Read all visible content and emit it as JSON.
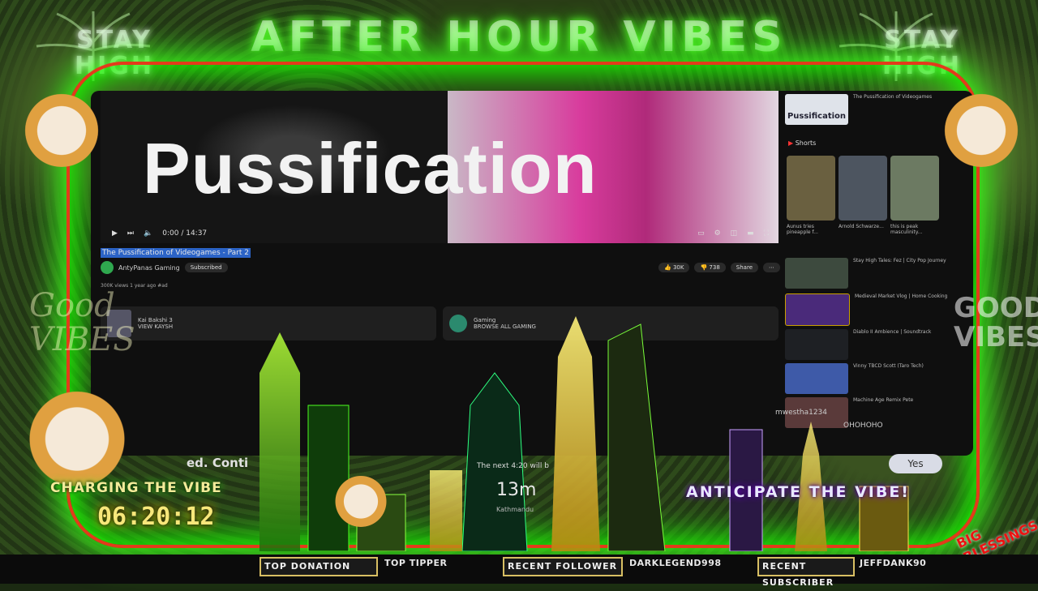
{
  "overlay": {
    "banner_title": "AFTER HOUR VIBES",
    "stay_high": "STAY HIGH",
    "good_vibes_left": "Good VIBES",
    "good_vibes_right": "GOOD VIBES",
    "charging_label": "CHARGING THE VIBE",
    "countdown": "06:20:12",
    "anticipate_label": "ANTICIPATE THE VIBE!",
    "big_blessings": "BIG BLESSINGS",
    "webcam_caption": "ed. Conti",
    "accent_green": "#38ff18",
    "accent_red": "#e33b1a"
  },
  "video": {
    "overlay_title": "Pussification",
    "title": "The Pussification of Videogames - Part 2",
    "channel": "AntyPanas Gaming",
    "subscribe": "Subscribed",
    "likes": "30K",
    "dislikes": "738",
    "share": "Share",
    "time": "0:00 / 14:37",
    "description": "300K views  1 year ago  #ad"
  },
  "cards": [
    {
      "title": "Kai Bakshi 3",
      "sub": "VIEW KAYSH"
    },
    {
      "title": "Gaming",
      "sub": "BROWSE ALL GAMING"
    }
  ],
  "sidebar": {
    "top_title": "The Pussification of Videogames",
    "top_label": "Pussification",
    "shorts_label": "Shorts",
    "shorts": [
      {
        "caption": "Aunus tries pineapple f..."
      },
      {
        "caption": "Arnold Schwarze..."
      },
      {
        "caption": "this is peak masculinity..."
      }
    ],
    "items": [
      {
        "title": "Stay High Tales: Fez | City Pop Journey"
      },
      {
        "title": "Medieval Market Vlog | Home Cooking"
      },
      {
        "title": "Diablo II Ambience | Soundtrack"
      },
      {
        "title": "Vinny TBCD Scott (Taro Tech)"
      },
      {
        "title": "Machine Age Remix Pete"
      }
    ]
  },
  "chat": {
    "line1": "mwestha1234",
    "line2": "OHOHOHO",
    "yes": "Yes"
  },
  "next_up": {
    "text": "The next 4:20 will b",
    "time": "13m",
    "place": "Kathmandu"
  },
  "bottom_bar": {
    "top_donation": "TOP DONATION",
    "top_tipper": "TOP TIPPER",
    "recent_follower": "RECENT FOLLOWER",
    "follower_name": "DARKLEGEND998",
    "recent_subscriber": "RECENT SUBSCRIBER",
    "subscriber_name": "JEFFDANK90"
  }
}
